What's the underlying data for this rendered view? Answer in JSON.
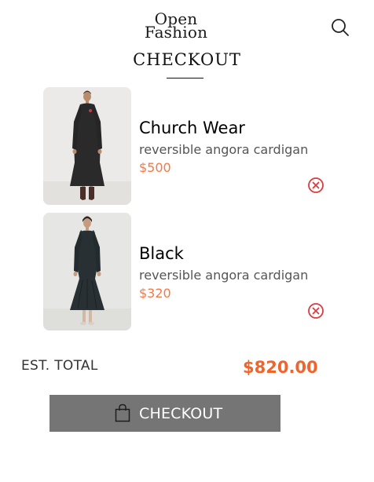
{
  "brand": {
    "line1": "Open",
    "line2": "Fashion"
  },
  "header": {
    "search_icon": "search-icon"
  },
  "page": {
    "title": "CHECKOUT"
  },
  "cart": {
    "items": [
      {
        "name": "Church Wear",
        "description": "reversible angora cardigan",
        "price": "$500",
        "remove_icon": "close-circle-icon"
      },
      {
        "name": "Black",
        "description": "reversible angora cardigan",
        "price": "$320",
        "remove_icon": "close-circle-icon"
      }
    ]
  },
  "summary": {
    "total_label": "EST. TOTAL",
    "total_value": "$820.00"
  },
  "checkout_button": {
    "label": "CHECKOUT",
    "icon": "shopping-bag-icon"
  },
  "colors": {
    "accent": "#f0642d",
    "price": "#f07a4a",
    "remove": "#e0393e",
    "button": "#757575"
  }
}
